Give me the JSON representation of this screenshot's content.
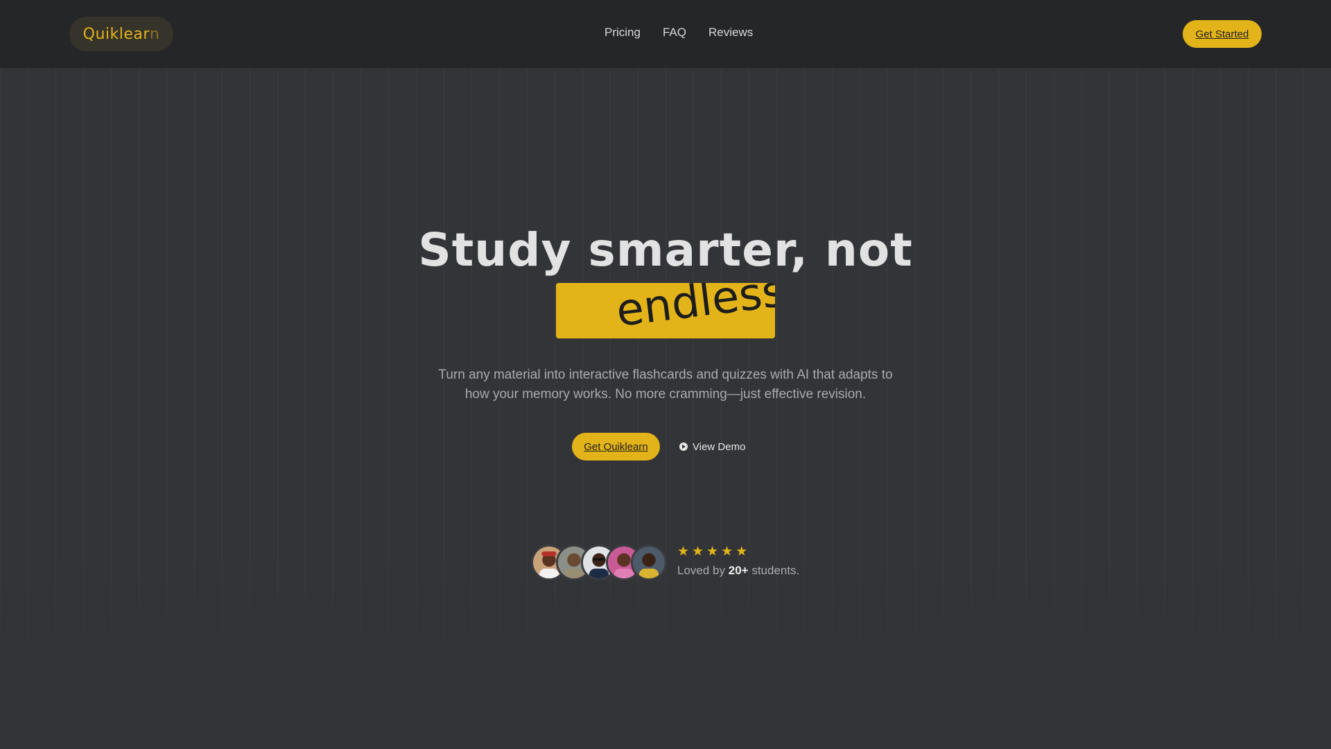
{
  "header": {
    "logo_main": "Quiklear",
    "logo_tail": "n",
    "nav": [
      "Pricing",
      "FAQ",
      "Reviews"
    ],
    "cta": "Get Started"
  },
  "hero": {
    "headline": "Study smarter, not",
    "highlight_word": "endlessly",
    "subtitle_line1": "Turn any material into interactive flashcards and quizzes with AI that adapts to",
    "subtitle_line2": "how your memory works. No more cramming—just effective revision.",
    "primary_cta": "Get Quiklearn",
    "secondary_cta": "View Demo"
  },
  "social_proof": {
    "rating_stars": 5,
    "loved_prefix": "Loved by",
    "count": "20+",
    "loved_suffix": "students."
  },
  "colors": {
    "accent": "#e3b41a",
    "background": "#333438",
    "header_bg": "#252628"
  },
  "icons": {
    "demo": "play-circle-icon",
    "rating": "star-icon"
  }
}
